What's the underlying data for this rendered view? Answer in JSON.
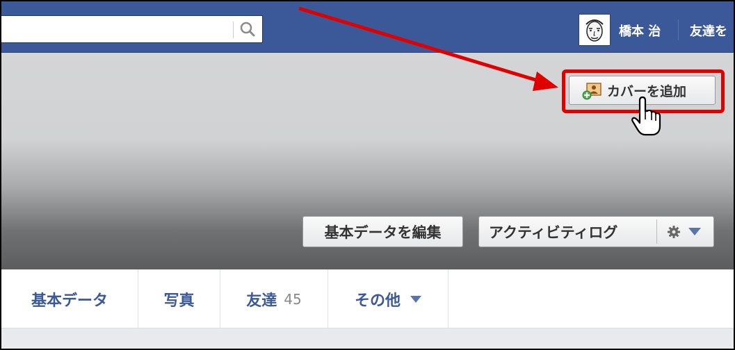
{
  "topbar": {
    "search": {
      "value": "",
      "placeholder": ""
    },
    "profile_name": "橋本 治",
    "friends_link": "友達を"
  },
  "cover": {
    "add_cover_label": "カバーを追加",
    "edit_profile_label": "基本データを編集",
    "activity_log_label": "アクティビティログ"
  },
  "tabs": [
    {
      "label": "基本データ"
    },
    {
      "label": "写真"
    },
    {
      "label": "友達",
      "count": "45"
    },
    {
      "label": "その他"
    }
  ],
  "icons": {
    "search": "search-icon",
    "add_cover": "add-photo-icon",
    "gear": "gear-icon",
    "caret": "chevron-down-icon",
    "pointer": "hand-pointer-icon",
    "arrow": "red-arrow-annotation"
  },
  "colors": {
    "brand": "#3b5998",
    "highlight": "#e00000"
  }
}
